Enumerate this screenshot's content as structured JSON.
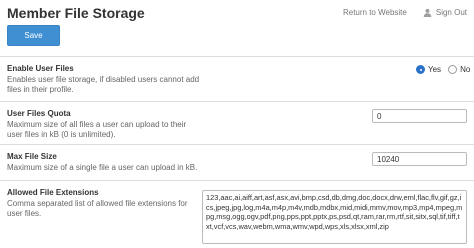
{
  "header": {
    "title": "Member File Storage",
    "return_link": "Return to Website",
    "sign_out": "Sign Out",
    "save_label": "Save"
  },
  "settings": {
    "enable_user_files": {
      "label": "Enable User Files",
      "description": "Enables user file storage, if disabled users cannot add files in their profile.",
      "options": [
        "Yes",
        "No"
      ],
      "selected": "Yes"
    },
    "user_files_quota": {
      "label": "User Files Quota",
      "description": "Maximum size of all files a user can upload to their user files in kB (0 is unlimited).",
      "value": "0"
    },
    "max_file_size": {
      "label": "Max File Size",
      "description": "Maximum size of a single file a user can upload in kB.",
      "value": "10240"
    },
    "allowed_extensions": {
      "label": "Allowed File Extensions",
      "description": "Comma separated list of allowed file extensions for user files.",
      "value": "123,aac,ai,aiff,art,asf,asx,avi,bmp,csd,db,dmg,doc,docx,drw,eml,flac,flv,gif,gz,ics,jpeg,jpg,log,m4a,m4p,m4v,mdb,mdbx,mid,midi,mmv,mov,mp3,mp4,mpeg,mpg,msg,ogg,ogv,pdf,png,pps,ppt,pptx,ps,psd,qt,ram,rar,rm,rtf,sit,sitx,sql,tif,tiff,txt,vcf,vcs,wav,webm,wma,wmv,wpd,wps,xls,xlsx,xml,zip"
    }
  },
  "icons": {
    "user": "user-icon"
  },
  "colors": {
    "accent": "#3f8fd2",
    "radio_selected": "#2a72c9"
  }
}
